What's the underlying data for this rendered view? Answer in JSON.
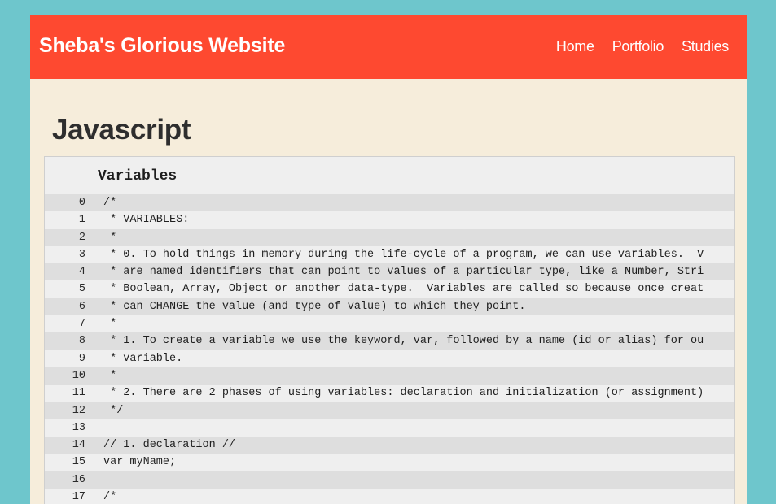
{
  "header": {
    "brand": "Sheba's Glorious Website",
    "nav": [
      "Home",
      "Portfolio",
      "Studies"
    ]
  },
  "main": {
    "title": "Javascript",
    "code_block": {
      "title": "Variables",
      "lines": [
        {
          "n": "0",
          "text": "/*"
        },
        {
          "n": "1",
          "text": " * VARIABLES:"
        },
        {
          "n": "2",
          "text": " *"
        },
        {
          "n": "3",
          "text": " * 0. To hold things in memory during the life-cycle of a program, we can use variables.  V"
        },
        {
          "n": "4",
          "text": " * are named identifiers that can point to values of a particular type, like a Number, Stri"
        },
        {
          "n": "5",
          "text": " * Boolean, Array, Object or another data-type.  Variables are called so because once creat"
        },
        {
          "n": "6",
          "text": " * can CHANGE the value (and type of value) to which they point."
        },
        {
          "n": "7",
          "text": " *"
        },
        {
          "n": "8",
          "text": " * 1. To create a variable we use the keyword, var, followed by a name (id or alias) for ou"
        },
        {
          "n": "9",
          "text": " * variable."
        },
        {
          "n": "10",
          "text": " *"
        },
        {
          "n": "11",
          "text": " * 2. There are 2 phases of using variables: declaration and initialization (or assignment)"
        },
        {
          "n": "12",
          "text": " */"
        },
        {
          "n": "13",
          "text": ""
        },
        {
          "n": "14",
          "text": "// 1. declaration //"
        },
        {
          "n": "15",
          "text": "var myName;"
        },
        {
          "n": "16",
          "text": ""
        },
        {
          "n": "17",
          "text": "/*"
        }
      ]
    }
  },
  "colors": {
    "background": "#6ec6cc",
    "navbar": "#fe4930",
    "page": "#f6eddb",
    "code_bg": "#efefef",
    "code_stripe": "#dedede"
  }
}
